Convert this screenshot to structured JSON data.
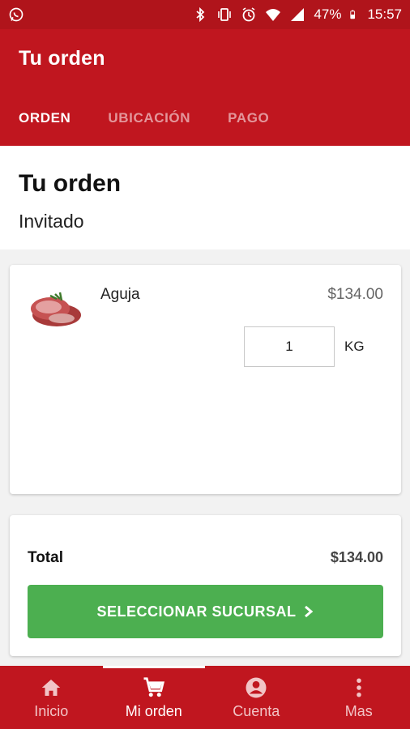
{
  "status_bar": {
    "battery": "47%",
    "time": "15:57",
    "icons": [
      "whatsapp-icon",
      "bluetooth-icon",
      "vibrate-icon",
      "alarm-icon",
      "wifi-icon",
      "signal-icon",
      "battery-icon"
    ]
  },
  "app_bar": {
    "title": "Tu orden",
    "tabs": [
      {
        "label": "ORDEN",
        "active": true
      },
      {
        "label": "UBICACIÓN",
        "active": false
      },
      {
        "label": "PAGO",
        "active": false
      }
    ]
  },
  "order": {
    "title": "Tu orden",
    "subtitle": "Invitado"
  },
  "items": [
    {
      "name": "Aguja",
      "price": "$134.00",
      "quantity": "1",
      "unit": "KG",
      "image_icon": "meat-icon"
    }
  ],
  "summary": {
    "total_label": "Total",
    "total_value": "$134.00",
    "button_label": "SELECCIONAR SUCURSAL"
  },
  "bottom_nav": [
    {
      "label": "Inicio",
      "icon": "home-icon",
      "active": false
    },
    {
      "label": "Mi orden",
      "icon": "cart-icon",
      "active": true
    },
    {
      "label": "Cuenta",
      "icon": "account-icon",
      "active": false
    },
    {
      "label": "Mas",
      "icon": "more-icon",
      "active": false
    }
  ],
  "colors": {
    "primary": "#c0161f",
    "status_bar": "#b0141b",
    "accent_button": "#4caf50"
  }
}
